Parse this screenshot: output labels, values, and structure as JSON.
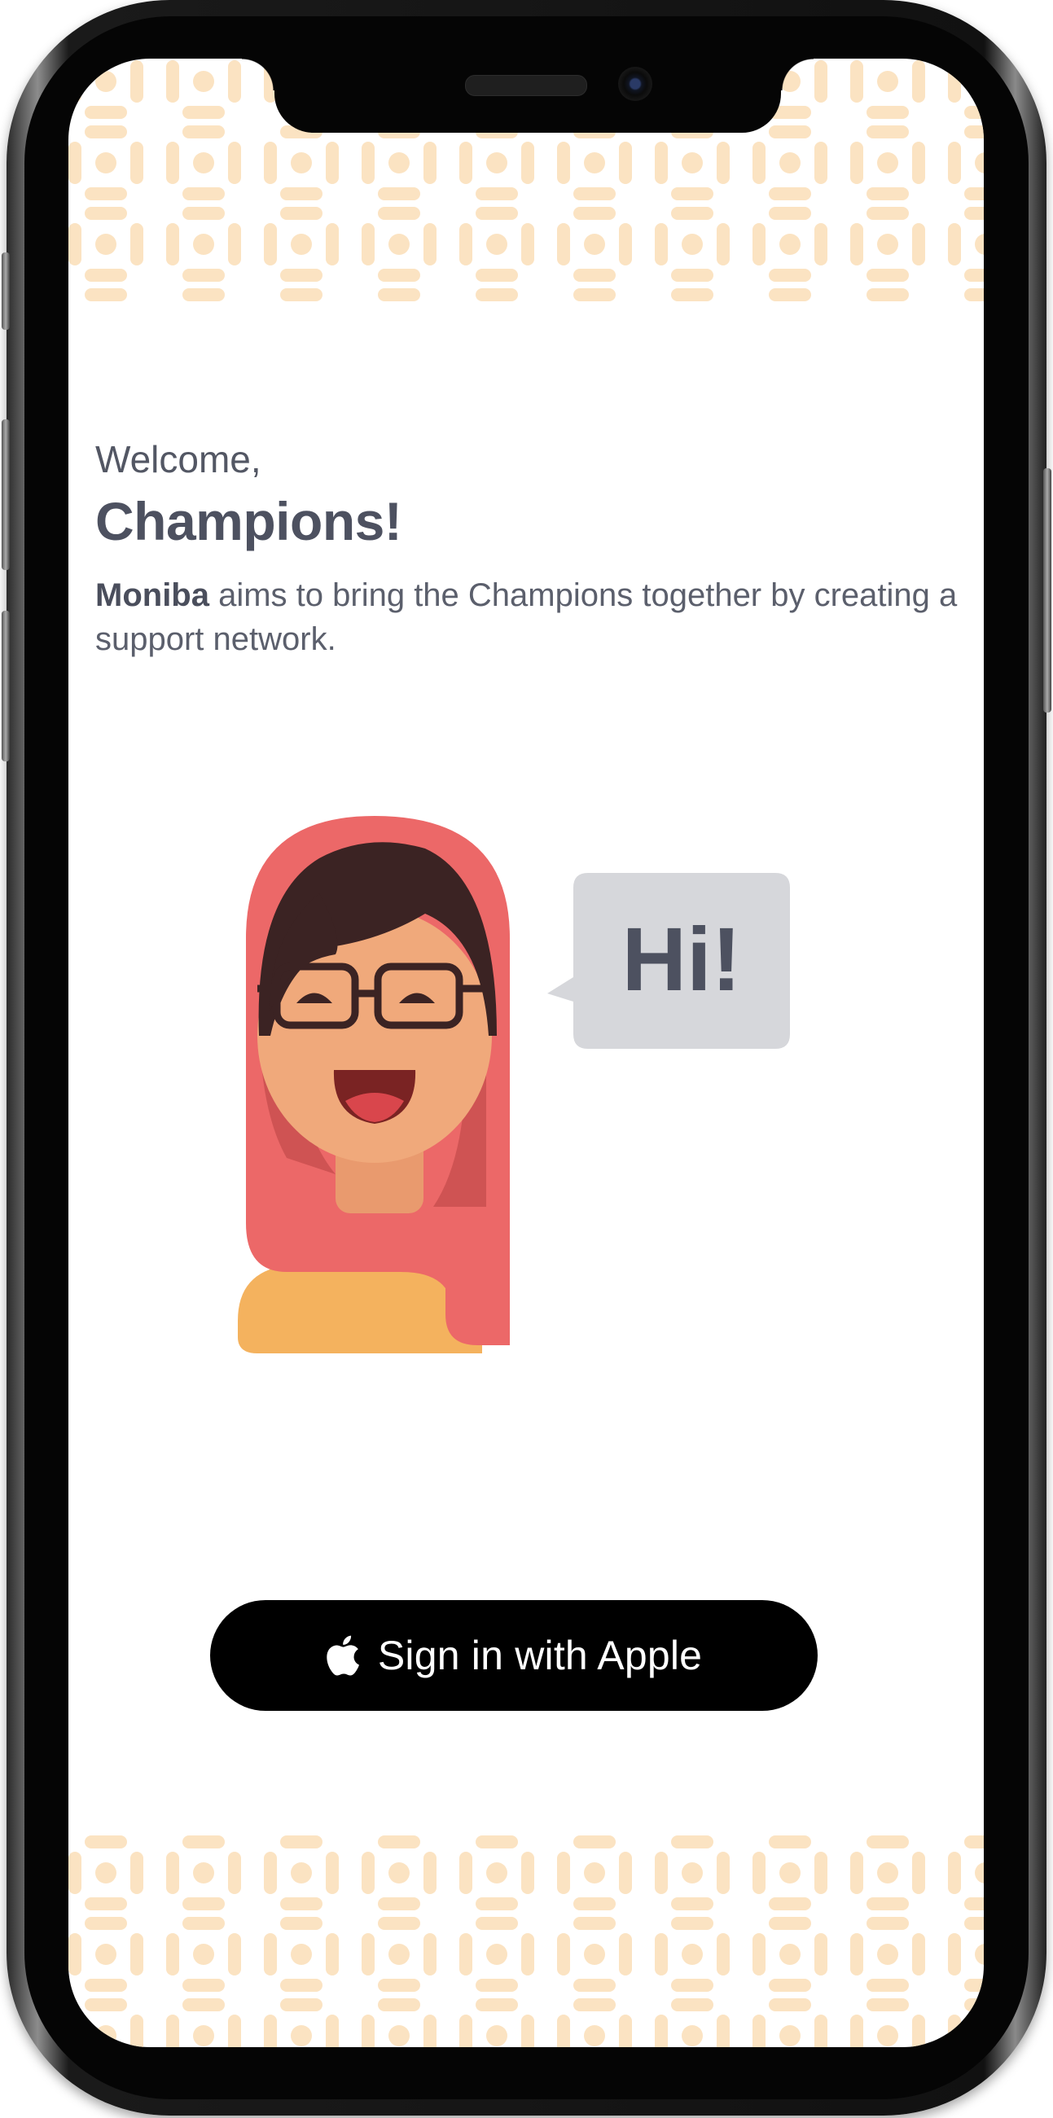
{
  "welcome": {
    "greeting": "Welcome,",
    "title": "Champions!",
    "description_brand": "Moniba",
    "description_rest": " aims to bring the Champions together by creating a support network."
  },
  "illustration": {
    "speech_bubble_text": "Hi!"
  },
  "sign_in": {
    "label": "Sign in with Apple",
    "icon": "apple-icon"
  },
  "colors": {
    "text_primary": "#4d5160",
    "pattern": "#fbe3c2",
    "button_bg": "#000000",
    "button_text": "#ffffff",
    "scarf": "#ec6868",
    "skin": "#f0a97b",
    "sweater": "#f4b25e",
    "bubble": "#d6d7db"
  }
}
